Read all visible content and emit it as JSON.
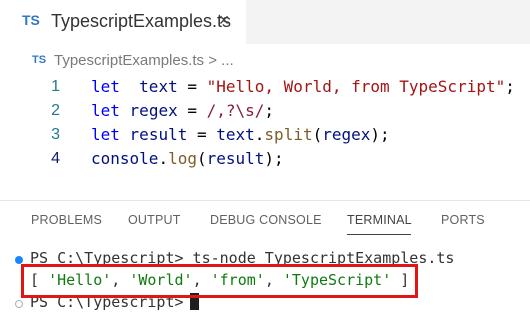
{
  "tab": {
    "lang_badge": "TS",
    "title": "TypescriptExamples.ts",
    "close_glyph": "×",
    "close_icon": "close-icon"
  },
  "breadcrumb": {
    "lang_badge": "TS",
    "file": "TypescriptExamples.ts",
    "separator": " > ",
    "ellipsis": "..."
  },
  "editor": {
    "lines": [
      {
        "number": "1",
        "tokens": [
          [
            "kw",
            "let"
          ],
          [
            "",
            "  "
          ],
          [
            "var",
            "text"
          ],
          [
            "",
            " = "
          ],
          [
            "str",
            "\"Hello, World, from TypeScript\""
          ],
          [
            "",
            ";"
          ]
        ]
      },
      {
        "number": "2",
        "tokens": [
          [
            "kw",
            "let"
          ],
          [
            "",
            " "
          ],
          [
            "var",
            "regex"
          ],
          [
            "",
            " = "
          ],
          [
            "re",
            "/,?\\s/"
          ],
          [
            "",
            ";"
          ]
        ]
      },
      {
        "number": "3",
        "tokens": [
          [
            "kw",
            "let"
          ],
          [
            "",
            " "
          ],
          [
            "var",
            "result"
          ],
          [
            "",
            " = "
          ],
          [
            "var",
            "text"
          ],
          [
            "",
            "."
          ],
          [
            "fn",
            "split"
          ],
          [
            "",
            "("
          ],
          [
            "var",
            "regex"
          ],
          [
            "",
            ");"
          ]
        ]
      },
      {
        "number": "4",
        "tokens": [
          [
            "var",
            "console"
          ],
          [
            "",
            "."
          ],
          [
            "fn",
            "log"
          ],
          [
            "",
            "("
          ],
          [
            "var",
            "result"
          ],
          [
            "",
            ");"
          ]
        ]
      }
    ],
    "active_line": "4"
  },
  "panel": {
    "tabs": [
      "PROBLEMS",
      "OUTPUT",
      "DEBUG CONSOLE",
      "TERMINAL",
      "PORTS"
    ],
    "active_tab": "TERMINAL"
  },
  "terminal": {
    "command_line": "PS C:\\Typescript> ts-node TypescriptExamples.ts",
    "output_open": "[ ",
    "output_items": [
      "'Hello'",
      "'World'",
      "'from'",
      "'TypeScript'"
    ],
    "output_sep": ", ",
    "output_close": " ]",
    "prompt": "PS C:\\Typescript>"
  },
  "colors": {
    "highlight_border": "#e01515",
    "ts_badge": "#3178c6",
    "terminal_string": "#0f7b0f"
  }
}
